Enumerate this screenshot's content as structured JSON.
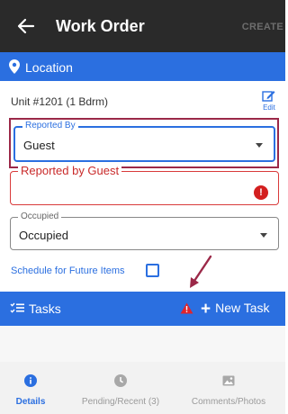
{
  "app_bar": {
    "title": "Work Order",
    "action_label": "CREATE"
  },
  "location_bar": {
    "label": "Location"
  },
  "unit": {
    "name": "Unit #1201 (1 Bdrm)",
    "edit_label": "Edit"
  },
  "form": {
    "reported_by": {
      "label": "Reported By",
      "value": "Guest"
    },
    "reported_by_guest": {
      "label": "Reported by Guest",
      "value": ""
    },
    "occupied": {
      "label": "Occupied",
      "value": "Occupied"
    },
    "schedule_label": "Schedule for Future Items",
    "schedule_checked": false
  },
  "tasks_bar": {
    "label": "Tasks",
    "new_task_label": "New Task"
  },
  "bottom_nav": {
    "items": [
      {
        "label": "Details",
        "icon": "info-icon",
        "active": true
      },
      {
        "label": "Pending/Recent (3)",
        "icon": "clock-icon",
        "active": false
      },
      {
        "label": "Comments/Photos",
        "icon": "photo-icon",
        "active": false
      }
    ]
  },
  "colors": {
    "primary": "#2b6fe0",
    "appbar": "#2a2a2a",
    "error": "#d31f1f",
    "highlight": "#9b2848"
  }
}
